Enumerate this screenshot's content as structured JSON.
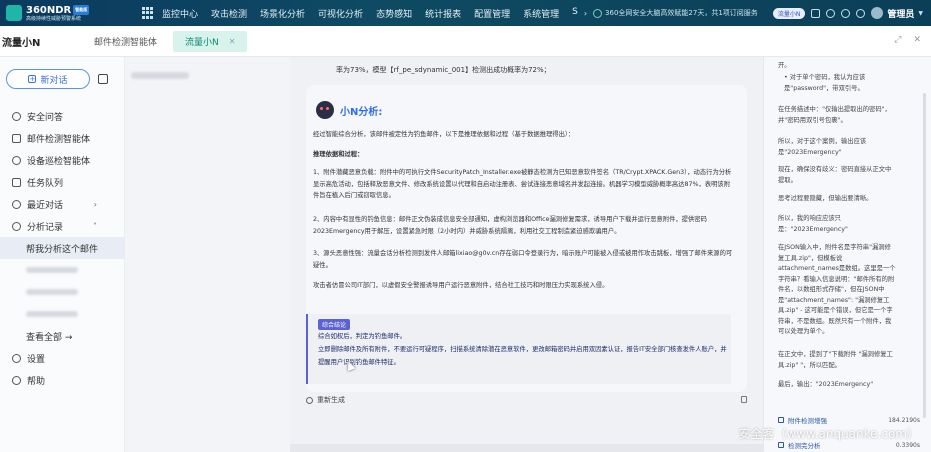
{
  "app": {
    "brand_title": "360NDR",
    "brand_badge": "智能版",
    "brand_subtitle": "高级持续性威胁预警系统"
  },
  "nav": {
    "items": [
      "监控中心",
      "攻击检测",
      "场景化分析",
      "可视化分析",
      "态势感知",
      "统计报表",
      "配置管理",
      "系统管理",
      "S"
    ],
    "notice": "360全网安全大脑高效赋能27天，共1项订阅服务",
    "pill": "流量小N",
    "user": "管理员"
  },
  "tabs": {
    "page_title": "流量小N",
    "items": [
      {
        "label": "邮件检测智能体",
        "active": false
      },
      {
        "label": "流量小N",
        "active": true
      }
    ]
  },
  "sidebar": {
    "new_chat": "新对话",
    "menu": [
      {
        "label": "安全问答",
        "icon": "chat-icon"
      },
      {
        "label": "邮件检测智能体",
        "icon": "mail-icon"
      },
      {
        "label": "设备巡检智能体",
        "icon": "device-icon"
      },
      {
        "label": "任务队列",
        "icon": "task-icon"
      },
      {
        "label": "最近对话",
        "icon": "history-icon",
        "chevron": "›"
      },
      {
        "label": "分析记录",
        "icon": "record-icon",
        "chevron": "˅"
      }
    ],
    "active_sub": "帮我分析这个邮件",
    "see_all": "查看全部 →",
    "settings": "设置",
    "help": "帮助"
  },
  "chat": {
    "top_line": "率为73%，模型【rf_pe_sdynamic_001】检测出成功概率为72%；",
    "ai_title": "小N分析:",
    "intro": "经过智能综合分析，该邮件被定性为钓鱼邮件，以下是推理依据和过程（基于数据推理得出）：",
    "reason_title": "推理依据和过程：",
    "p1": "1、附件潜藏恶意负载：附件中的可执行文件SecurityPatch_Installer.exe被静态检测为已知恶意软件签名（TR/Crypt.XPACK.Gen3），动态行为分析显示高危活动，包括释放恶意文件、修改系统设置以代理和自启动注册表、尝试连接恶意域名并发起连接。机器学习模型威胁概率高达87%，表明该附件旨在植入后门或窃取信息。",
    "p2": "2、内容中有显性的钓鱼信息：邮件正文伪装成信息安全部通知，虚构浏览器和Office漏洞修复需求，诱导用户下载并运行恶意附件，提供密码2023Emergency用于解压，设置紧急时限（2小时内）并威胁系统隔离，利用社交工程制造紧迫感欺骗用户。",
    "p3": "3、源头恶意性强：流量会话分析检测到发件人邮箱lixiao@g0v.cn存在弱口令登录行为，暗示账户可能被入侵或被用作攻击跳板，增强了邮件来源的可疑性。",
    "p4": "攻击者仿冒公司IT部门，以虚假安全警报诱导用户运行恶意附件，结合社工技巧和时限压力实现系统入侵。",
    "conclusion_tag": "综合结论",
    "conclusion": [
      "综合如权后，判定为钓鱼邮件。",
      "立即删除邮件及所有附件，不要运行可疑程序，扫描系统清除潜在恶意软件，更改邮箱密码并启用双因素认证，报告IT安全部门核查发件人账户，并提醒用户识别钓鱼邮件特征。"
    ],
    "regenerate": "重新生成"
  },
  "right": {
    "lines": [
      "开。",
      "• 对于单个密码，我认为应该是\"password\"，带双引号。",
      "在任务描述中：\"仅输出提取出的密码\"，并\"密码用双引号包裹\"。",
      "所以，对于这个案例，输出应该是\"2023Emergency\"",
      "现在，确保没有歧义：密码直接从正文中提取。",
      "思考过程要隐藏，但输出要清晰。",
      "所以，我的响应应该只是：\"2023Emergency\"",
      "在JSON输入中，附件名是字符串\"漏洞修复工具.zip\"，但模板说attachment_names是数组。这里是一个字符串？看输入信息说明：\"邮件所有的附件名，以数组形式存储\"，但在JSON中是\"attachment_names\": \"漏洞修复工具.zip\" - 这可能是个错误，但它是一个字符串，不是数组。既然只有一个附件，我可以处理为单个。",
      "在正文中，提到了\"下载附件 \"漏洞修复工具.zip\" \"，所以匹配。",
      "最后，输出：\"2023Emergency\""
    ],
    "steps": [
      {
        "label": "附件检测增强",
        "time": "184.2190s"
      },
      {
        "label": "检测完分析",
        "time": "0.3390s"
      }
    ]
  },
  "watermark": "安全客（www.anquanke.com）"
}
